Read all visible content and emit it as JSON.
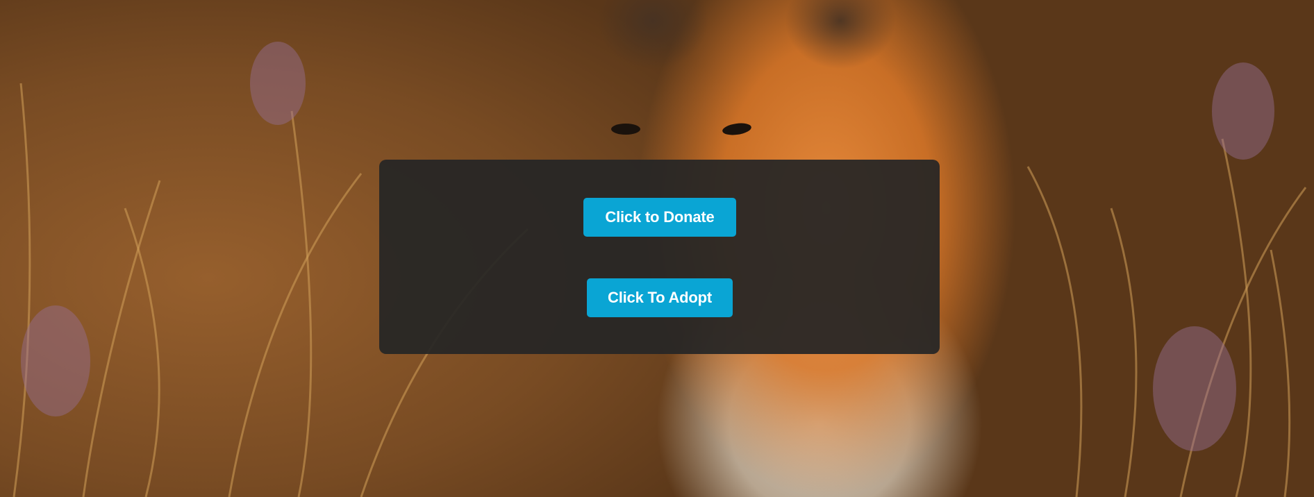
{
  "background": {
    "image_subject": "red fox in tall grass",
    "icon": "fox-photo"
  },
  "panel": {
    "buttons": {
      "donate_label": "Click to Donate",
      "adopt_label": "Click To Adopt"
    },
    "colors": {
      "panel_bg": "#262626",
      "button_bg": "#0aa5d4",
      "button_text": "#ffffff"
    }
  }
}
